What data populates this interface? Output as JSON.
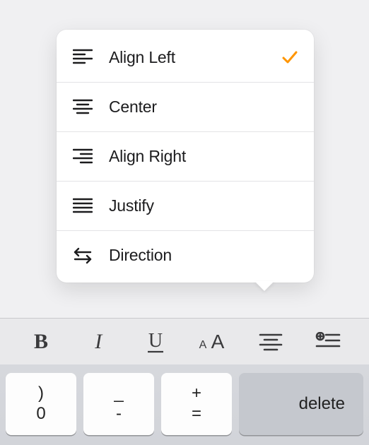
{
  "menu": {
    "items": [
      {
        "label": "Align Left",
        "icon": "align-left-icon",
        "checked": true
      },
      {
        "label": "Center",
        "icon": "align-center-icon",
        "checked": false
      },
      {
        "label": "Align Right",
        "icon": "align-right-icon",
        "checked": false
      },
      {
        "label": "Justify",
        "icon": "justify-icon",
        "checked": false
      },
      {
        "label": "Direction",
        "icon": "direction-icon",
        "checked": false
      }
    ]
  },
  "format_bar": {
    "bold": "B",
    "italic": "I",
    "underline": "U",
    "text_size": "aA",
    "paragraph": "paragraph-icon",
    "list": "list-add-icon"
  },
  "keyboard": {
    "keys": [
      {
        "top": ")",
        "bottom": "0"
      },
      {
        "top": "_",
        "bottom": "-"
      },
      {
        "top": "+",
        "bottom": "="
      }
    ],
    "delete_label": "delete"
  },
  "colors": {
    "accent": "#ff9500"
  }
}
